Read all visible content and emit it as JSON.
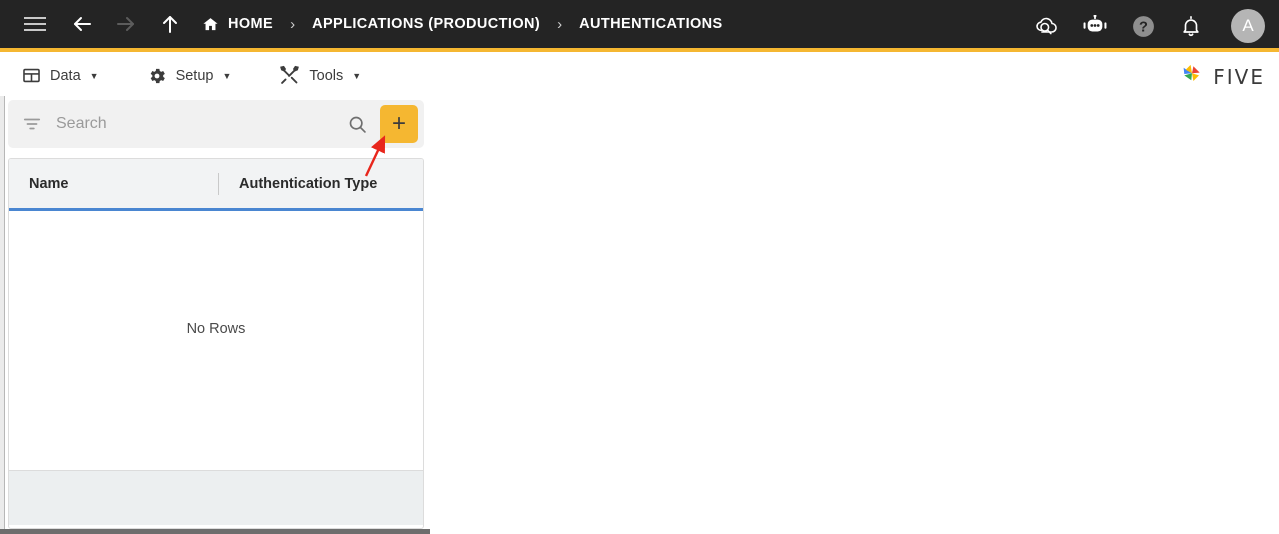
{
  "topbar": {
    "menu_icon": "hamburger-icon",
    "back_icon": "arrow-left-icon",
    "forward_icon": "arrow-right-icon",
    "up_icon": "arrow-up-icon",
    "breadcrumb": [
      {
        "label": "HOME",
        "icon": "home-icon"
      },
      {
        "label": "APPLICATIONS (PRODUCTION)",
        "icon": ""
      },
      {
        "label": "AUTHENTICATIONS",
        "icon": ""
      }
    ],
    "separator": "›",
    "right_icons": [
      {
        "name": "cloud-search-icon",
        "title": "Cloud Search"
      },
      {
        "name": "chatbot-icon",
        "title": "Assistant"
      },
      {
        "name": "help-icon",
        "title": "Help"
      },
      {
        "name": "notifications-bell-icon",
        "title": "Notifications"
      }
    ],
    "avatar_initial": "A",
    "accent_color": "#F5B731",
    "background_color": "#242424"
  },
  "menubar": {
    "items": [
      {
        "label": "Data",
        "icon": "table-grid-icon",
        "caret": "▼"
      },
      {
        "label": "Setup",
        "icon": "gear-icon",
        "caret": "▼"
      },
      {
        "label": "Tools",
        "icon": "tools-icon",
        "caret": "▼"
      }
    ],
    "brand": {
      "text": "FIVE",
      "logo": "five-pinwheel-logo"
    }
  },
  "panel": {
    "search": {
      "placeholder": "Search",
      "value": "",
      "filter_icon": "filter-icon",
      "search_icon": "search-icon"
    },
    "add_button": {
      "label": "+",
      "name": "add-record-button",
      "color": "#F5B731"
    },
    "grid": {
      "columns": [
        "Name",
        "Authentication Type"
      ],
      "rows": [],
      "empty_message": "No Rows",
      "header_underline_color": "#4a86d1"
    }
  },
  "annotation": {
    "arrow": {
      "color": "#e8261c",
      "points_to": "add-record-button"
    }
  }
}
